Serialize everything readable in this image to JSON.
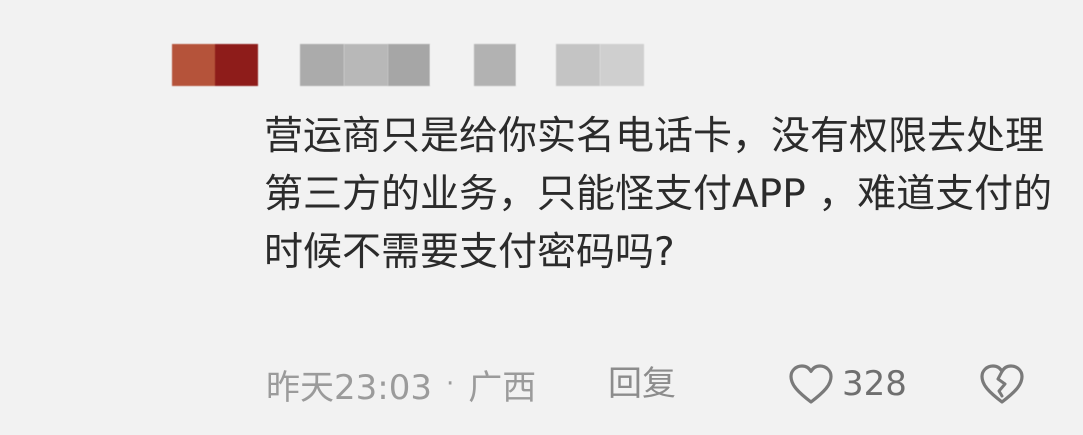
{
  "comment": {
    "text": "营运商只是给你实名电话卡，没有权限去处理第三方的业务，只能怪支付APP ，难道支付的时候不需要支付密码吗?",
    "time": "昨天23:03",
    "separator": "·",
    "location": "广西",
    "reply_label": "回复",
    "like_count": "328",
    "like_icon": "heart-outline-icon",
    "dislike_icon": "broken-heart-icon"
  },
  "avatar": {
    "pixel_colors": [
      "#b5533a",
      "#8e1c1a"
    ]
  },
  "username": {
    "pixel_colors": [
      "#ababab",
      "#b8b8b8",
      "#a6a6a6",
      "#cfcfcf",
      "#b2b2b2",
      "#c4c4c4"
    ]
  },
  "colors": {
    "background": "#f2f2f2",
    "text": "#2b2b2b",
    "meta": "#9b9b9b",
    "icon": "#7a7a7a"
  }
}
